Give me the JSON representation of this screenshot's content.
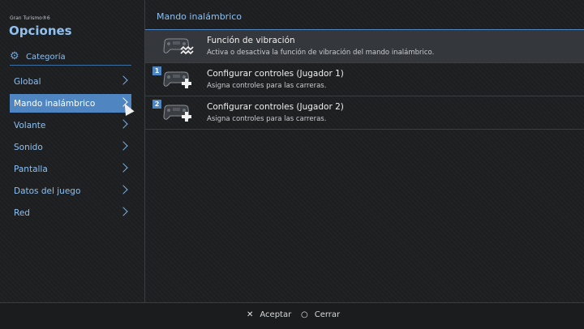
{
  "header": {
    "game_label": "Gran Turismo®6",
    "title": "Opciones",
    "category_label": "Categoría"
  },
  "menu": [
    {
      "label": "Global"
    },
    {
      "label": "Mando inalámbrico",
      "active": true
    },
    {
      "label": "Volante"
    },
    {
      "label": "Sonido"
    },
    {
      "label": "Pantalla"
    },
    {
      "label": "Datos del juego"
    },
    {
      "label": "Red"
    }
  ],
  "main": {
    "section_title": "Mando inalámbrico",
    "items": [
      {
        "title": "Función de vibración",
        "description": "Activa o desactiva la función de vibración del mando inalámbrico.",
        "badge": ""
      },
      {
        "title": "Configurar controles (Jugador 1)",
        "description": "Asigna controles para las carreras.",
        "badge": "1"
      },
      {
        "title": "Configurar controles (Jugador 2)",
        "description": "Asigna controles para las carreras.",
        "badge": "2"
      }
    ]
  },
  "footer": {
    "accept_symbol": "✕",
    "accept_label": "Aceptar",
    "close_symbol": "○",
    "close_label": "Cerrar"
  },
  "icons": {
    "category": "gear-icon",
    "vibration": "controller-vibration-icon",
    "controls": "controller-dpad-icon"
  },
  "colors": {
    "accent": "#4f86c2",
    "title_blue": "#8fc0f0",
    "background": "#1e1f21"
  }
}
